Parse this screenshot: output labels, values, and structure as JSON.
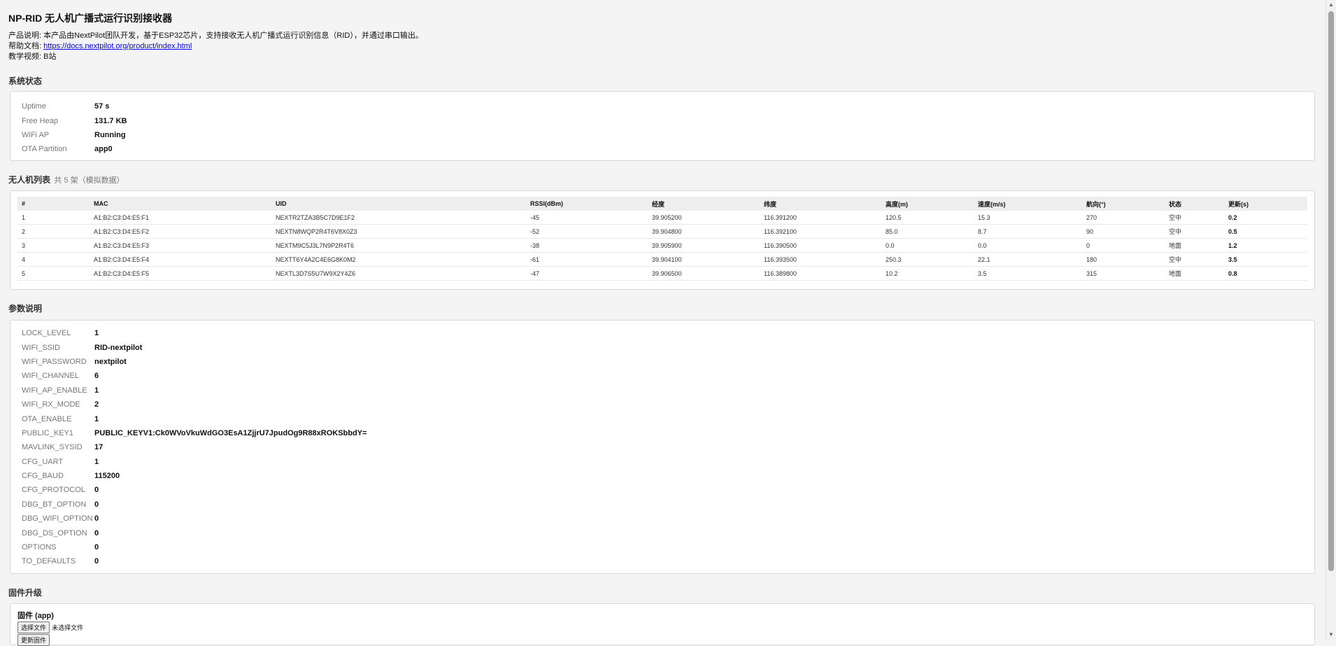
{
  "header": {
    "title": "NP-RID 无人机广播式运行识别接收器",
    "desc_label": "产品说明:",
    "desc_text": "本产品由NextPilot团队开发，基于ESP32芯片，支持接收无人机广播式运行识别信息（RID），并通过串口输出。",
    "help_label": "帮助文档:",
    "help_link": "https://docs.nextpilot.org/product/index.html",
    "video_label": "教学视频:",
    "video_value": "B站"
  },
  "system": {
    "title": "系统状态",
    "rows": [
      {
        "key": "Uptime",
        "value": "57 s"
      },
      {
        "key": "Free Heap",
        "value": "131.7 KB"
      },
      {
        "key": "WiFi AP",
        "value": "Running"
      },
      {
        "key": "OTA Partition",
        "value": "app0"
      }
    ]
  },
  "drones": {
    "title": "无人机列表",
    "count_note": "共 5 架（模拟数据）",
    "columns": [
      "#",
      "MAC",
      "UID",
      "RSSI(dBm)",
      "经度",
      "纬度",
      "高度(m)",
      "速度(m/s)",
      "航向(°)",
      "状态",
      "更新(s)"
    ],
    "rows": [
      [
        "1",
        "A1:B2:C3:D4:E5:F1",
        "NEXTR2TZA3B5C7D9E1F2",
        "-45",
        "39.905200",
        "116.391200",
        "120.5",
        "15.3",
        "270",
        "空中",
        "0.2"
      ],
      [
        "2",
        "A1:B2:C3:D4:E5:F2",
        "NEXTN8WQP2R4T6V8X0Z3",
        "-52",
        "39.904800",
        "116.392100",
        "85.0",
        "8.7",
        "90",
        "空中",
        "0.5"
      ],
      [
        "3",
        "A1:B2:C3:D4:E5:F3",
        "NEXTM9C5J3L7N9P2R4T6",
        "-38",
        "39.905900",
        "116.390500",
        "0.0",
        "0.0",
        "0",
        "地面",
        "1.2"
      ],
      [
        "4",
        "A1:B2:C3:D4:E5:F4",
        "NEXTT6Y4A2C4E6G8K0M2",
        "-61",
        "39.904100",
        "116.393500",
        "250.3",
        "22.1",
        "180",
        "空中",
        "3.5"
      ],
      [
        "5",
        "A1:B2:C3:D4:E5:F5",
        "NEXTL3D7S5U7W9X2Y4Z6",
        "-47",
        "39.906500",
        "116.389800",
        "10.2",
        "3.5",
        "315",
        "地面",
        "0.8"
      ]
    ]
  },
  "params": {
    "title": "参数说明",
    "rows": [
      {
        "key": "LOCK_LEVEL",
        "value": "1"
      },
      {
        "key": "WIFI_SSID",
        "value": "RID-nextpilot"
      },
      {
        "key": "WIFI_PASSWORD",
        "value": "nextpilot"
      },
      {
        "key": "WIFI_CHANNEL",
        "value": "6"
      },
      {
        "key": "WIFI_AP_ENABLE",
        "value": "1"
      },
      {
        "key": "WIFI_RX_MODE",
        "value": "2"
      },
      {
        "key": "OTA_ENABLE",
        "value": "1"
      },
      {
        "key": "PUBLIC_KEY1",
        "value": "PUBLIC_KEYV1:Ck0WVoVkuWdGO3EsA1ZjjrU7JpudOg9R88xROKSbbdY="
      },
      {
        "key": "MAVLINK_SYSID",
        "value": "17"
      },
      {
        "key": "CFG_UART",
        "value": "1"
      },
      {
        "key": "CFG_BAUD",
        "value": "115200"
      },
      {
        "key": "CFG_PROTOCOL",
        "value": "0"
      },
      {
        "key": "DBG_BT_OPTION",
        "value": "0"
      },
      {
        "key": "DBG_WIFI_OPTION",
        "value": "0"
      },
      {
        "key": "DBG_DS_OPTION",
        "value": "0"
      },
      {
        "key": "OPTIONS",
        "value": "0"
      },
      {
        "key": "TO_DEFAULTS",
        "value": "0"
      }
    ]
  },
  "firmware": {
    "title": "固件升级",
    "label": "固件 (app)",
    "choose_file": "选择文件",
    "no_file": "未选择文件",
    "update_button": "更新固件"
  }
}
